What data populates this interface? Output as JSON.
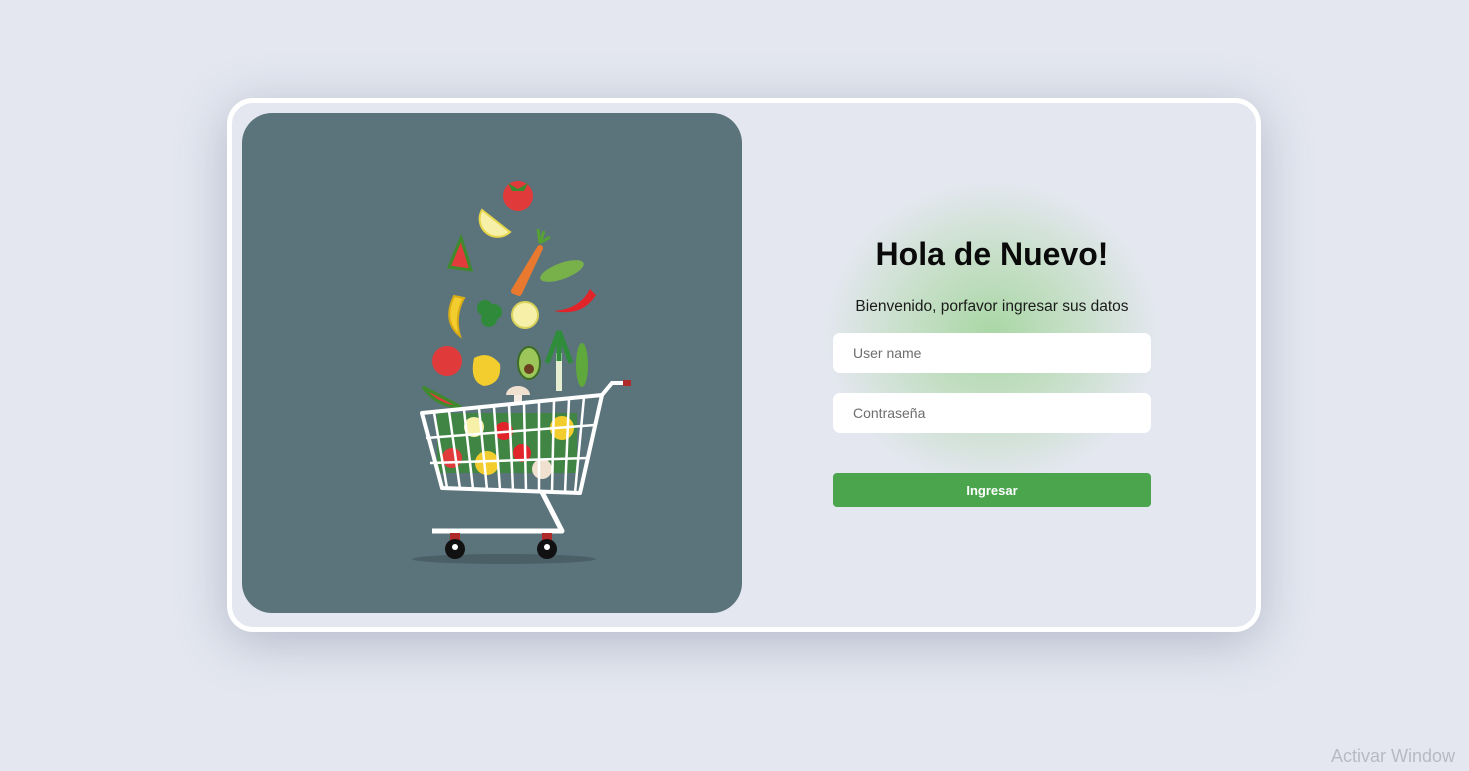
{
  "login": {
    "title": "Hola de Nuevo!",
    "subtitle": "Bienvenido, porfavor ingresar sus datos",
    "username_placeholder": "User name",
    "password_placeholder": "Contraseña",
    "submit_label": "Ingresar"
  },
  "illustration": {
    "icon": "shopping-cart-with-vegetables-icon"
  },
  "watermark": {
    "text": "Activar Window"
  },
  "colors": {
    "background": "#e4e7f0",
    "illustration_bg": "#5b747c",
    "accent": "#4aa54d",
    "card_border": "#ffffff"
  }
}
